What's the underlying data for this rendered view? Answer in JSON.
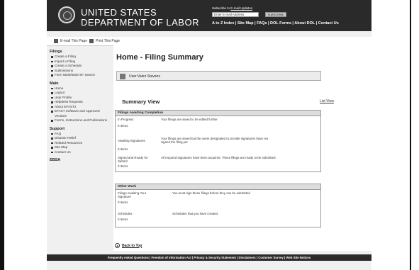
{
  "header": {
    "dept_line1": "UNITED STATES",
    "dept_line2": "DEPARTMENT OF LABOR",
    "subscribe_prefix": "Subscribe to ",
    "subscribe_link": "E-mail Updates",
    "email_placeholder": "Enter E-mail Address",
    "subscribe_button": "SUBSCRIBE",
    "top_links": "A to Z Index | Site Map | FAQs | DOL Forms | About DOL | Contact Us"
  },
  "toolbar": {
    "email_page": "E-mail This Page",
    "print_page": "Print This Page"
  },
  "sidebar": {
    "filings_heading": "Filings",
    "filings_items": [
      "Create a Filing",
      "Import a Filing",
      "Create a Schedule",
      "Submissions",
      "Form 5500/5500-SF Search"
    ],
    "main_heading": "Main",
    "main_items": [
      "Home",
      "Logout",
      "User Profile",
      "Helpdesk Requests",
      "About EFAST2",
      "EFAST Software and Approved Vendors",
      "Forms, Instructions and Publications"
    ],
    "support_heading": "Support",
    "support_items": [
      "FAQ",
      "Disaster Relief",
      "Related Resources",
      "Site Map",
      "Contact Us"
    ],
    "ebsa_heading": "EBSA"
  },
  "main": {
    "title": "Home - Filing Summary",
    "user_label": "User:Valen Stevens",
    "summary_heading": "Summary View",
    "list_view": "List View",
    "awaiting_heading": "Filings Awaiting Completion",
    "awaiting_rows": [
      {
        "label": "In Progress",
        "desc": "Your filings are saved to be edited further",
        "count": "0 Items"
      },
      {
        "label": "Awaiting Signatures",
        "desc": "Your filings are saved but the users designated to provide signatures have not signed the filing yet",
        "count": "0 Items"
      },
      {
        "label": "Signed and Ready for Submit",
        "desc": "All required signatures have been acquired. These filings are ready to be submitted.",
        "count": "0 Items"
      }
    ],
    "other_heading": "Other Work",
    "other_rows": [
      {
        "label": "Filings Awaiting Your Signature",
        "desc": "You must sign these filings before they can be submitted",
        "count": "0 Items"
      },
      {
        "label": "Schedules",
        "desc": "Schedules that you have created",
        "count": "0 Items"
      }
    ],
    "back_to_top": "Back to Top"
  },
  "footer": {
    "links": "Frequently Asked Questions | Freedom of Information Act | Privacy & Security Statement | Disclaimers | Customer Survey | Web Site Notices"
  }
}
